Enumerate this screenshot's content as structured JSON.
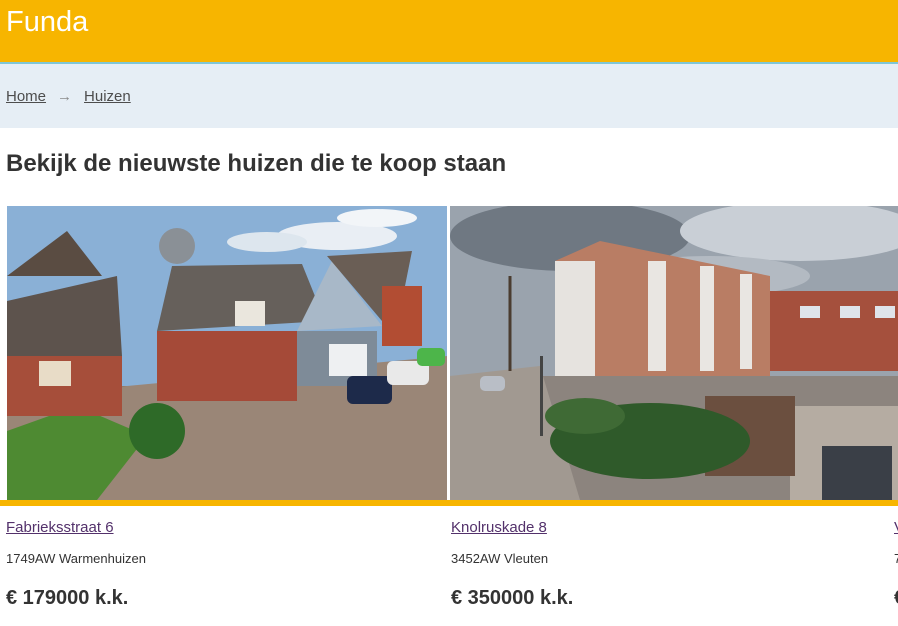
{
  "app": {
    "logo": "Funda",
    "accent_color": "#f7b500"
  },
  "breadcrumb": {
    "home": "Home",
    "separator": "→",
    "current": "Huizen"
  },
  "main": {
    "title": "Bekijk de nieuwste huizen die te koop staan"
  },
  "listings": [
    {
      "street": "Fabrieksstraat 6",
      "postal_city": "1749AW Warmenhuizen",
      "price": "€ 179000 k.k."
    },
    {
      "street": "Knolruskade 8",
      "postal_city": "3452AW Vleuten",
      "price": "€ 350000 k.k."
    },
    {
      "street": "V",
      "postal_city": "7",
      "price": "€"
    }
  ]
}
